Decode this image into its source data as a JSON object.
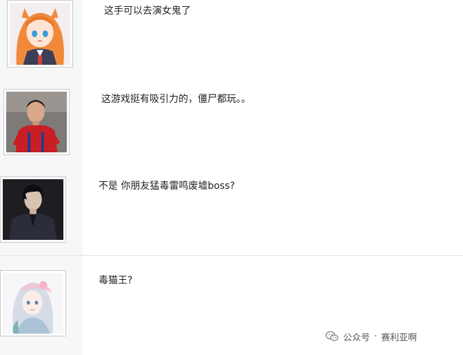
{
  "comments": [
    {
      "text": "这手可以去演女鬼了",
      "avatar_icon": "anime-girl-avatar"
    },
    {
      "text": "这游戏挺有吸引力的，僵尸都玩。。",
      "avatar_icon": "football-player-avatar"
    },
    {
      "text": "不是 你朋友猛毒雷鸣废墟boss?",
      "avatar_icon": "man-portrait-avatar"
    },
    {
      "text": "毒猫王?",
      "avatar_icon": "fantasy-girl-avatar"
    }
  ],
  "watermark": {
    "prefix": "公众号",
    "separator": "·",
    "name": "赛利亚啊",
    "icon": "wechat-icon"
  },
  "colors": {
    "left_column_bg": "#f6f7f9",
    "divider": "#e3e3e3",
    "text": "#222222"
  }
}
